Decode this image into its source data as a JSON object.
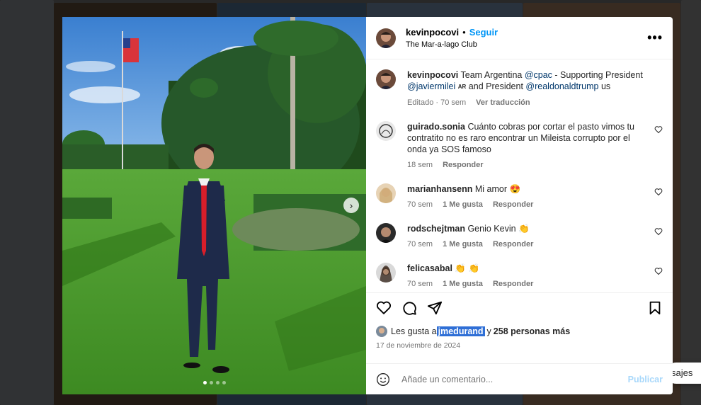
{
  "header": {
    "username": "kevinpocovi",
    "separator": "•",
    "follow_label": "Seguir",
    "location": "The Mar-a-lago Club",
    "more_label": "•••"
  },
  "caption": {
    "username": "kevinpocovi",
    "text_1": "Team Argentina",
    "mention_1": "@cpac",
    "text_2": "- Supporting President",
    "mention_2": "@javiermilei",
    "badge_ar": "AR",
    "text_3": "and President",
    "mention_3": "@realdonaldtrump",
    "text_4": "us",
    "edited": "Editado",
    "time": "70 sem",
    "translate": "Ver traducción"
  },
  "comments": [
    {
      "username": "guirado.sonia",
      "text": "Cuánto cobras por cortar el pasto vimos tu contratito no es raro encontrar un Mileista corrupto por el onda ya SOS famoso",
      "time": "18 sem",
      "likes": "",
      "reply": "Responder"
    },
    {
      "username": "marianhansenn",
      "text": "Mi amor 😍",
      "time": "70 sem",
      "likes": "1 Me gusta",
      "reply": "Responder"
    },
    {
      "username": "rodschejtman",
      "text": "Genio Kevin 👏",
      "time": "70 sem",
      "likes": "1 Me gusta",
      "reply": "Responder"
    },
    {
      "username": "felicasabal",
      "text": "👏 👏",
      "time": "70 sem",
      "likes": "1 Me gusta",
      "reply": "Responder"
    }
  ],
  "likes": {
    "prefix": "Les gusta a",
    "user": "jmedurand",
    "suffix_1": "y",
    "others": "258 personas más"
  },
  "post_date": "17 de noviembre de 2024",
  "comment_box": {
    "placeholder": "Añade un comentario...",
    "publish_label": "Publicar"
  },
  "background": {
    "messages_label": "sajes"
  },
  "carousel": {
    "slide_count": 4,
    "active_index": 0
  },
  "colors": {
    "accent": "#0095f6",
    "link": "#00376b",
    "publish_disabled": "#a8d8fb",
    "selection": "#2f6fd6"
  }
}
